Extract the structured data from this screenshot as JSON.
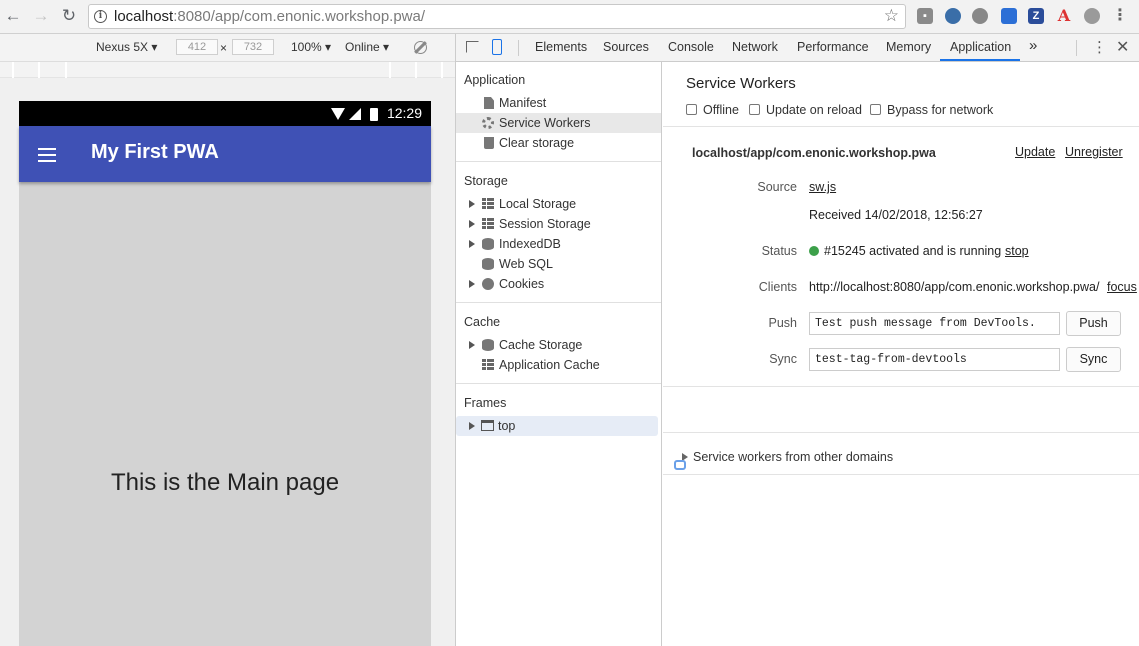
{
  "browser": {
    "url_host": "localhost",
    "url_rest": ":8080/app/com.enonic.workshop.pwa/"
  },
  "device_toolbar": {
    "device": "Nexus 5X",
    "width": "412",
    "height": "732",
    "times": "×",
    "zoom": "100%",
    "network": "Online"
  },
  "phone": {
    "time": "12:29",
    "app_title": "My First PWA",
    "main_text": "This is the Main page"
  },
  "devtools": {
    "tabs": [
      "Elements",
      "Sources",
      "Console",
      "Network",
      "Performance",
      "Memory",
      "Application"
    ],
    "more": "»",
    "sidebar": {
      "application_title": "Application",
      "application_items": [
        "Manifest",
        "Service Workers",
        "Clear storage"
      ],
      "storage_title": "Storage",
      "storage_items": [
        "Local Storage",
        "Session Storage",
        "IndexedDB",
        "Web SQL",
        "Cookies"
      ],
      "cache_title": "Cache",
      "cache_items": [
        "Cache Storage",
        "Application Cache"
      ],
      "frames_title": "Frames",
      "frames_items": [
        "top"
      ]
    },
    "panel": {
      "title": "Service Workers",
      "checkboxes": [
        "Offline",
        "Update on reload",
        "Bypass for network"
      ],
      "scope": "localhost/app/com.enonic.workshop.pwa",
      "update": "Update",
      "unregister": "Unregister",
      "source_label": "Source",
      "source_value": "sw.js",
      "received": "Received 14/02/2018, 12:56:27",
      "status_label": "Status",
      "status_value": "#15245 activated and is running",
      "stop": "stop",
      "clients_label": "Clients",
      "clients_value": "http://localhost:8080/app/com.enonic.workshop.pwa/",
      "focus": "focus",
      "push_label": "Push",
      "push_value": "Test push message from DevTools.",
      "push_button": "Push",
      "sync_label": "Sync",
      "sync_value": "test-tag-from-devtools",
      "sync_button": "Sync",
      "other_domains": "Service workers from other domains"
    }
  },
  "colors": {
    "app_bar": "#3f51b5",
    "status_ok": "#3ca04a",
    "link": "#1155cc",
    "accent": "#1a73e8"
  }
}
